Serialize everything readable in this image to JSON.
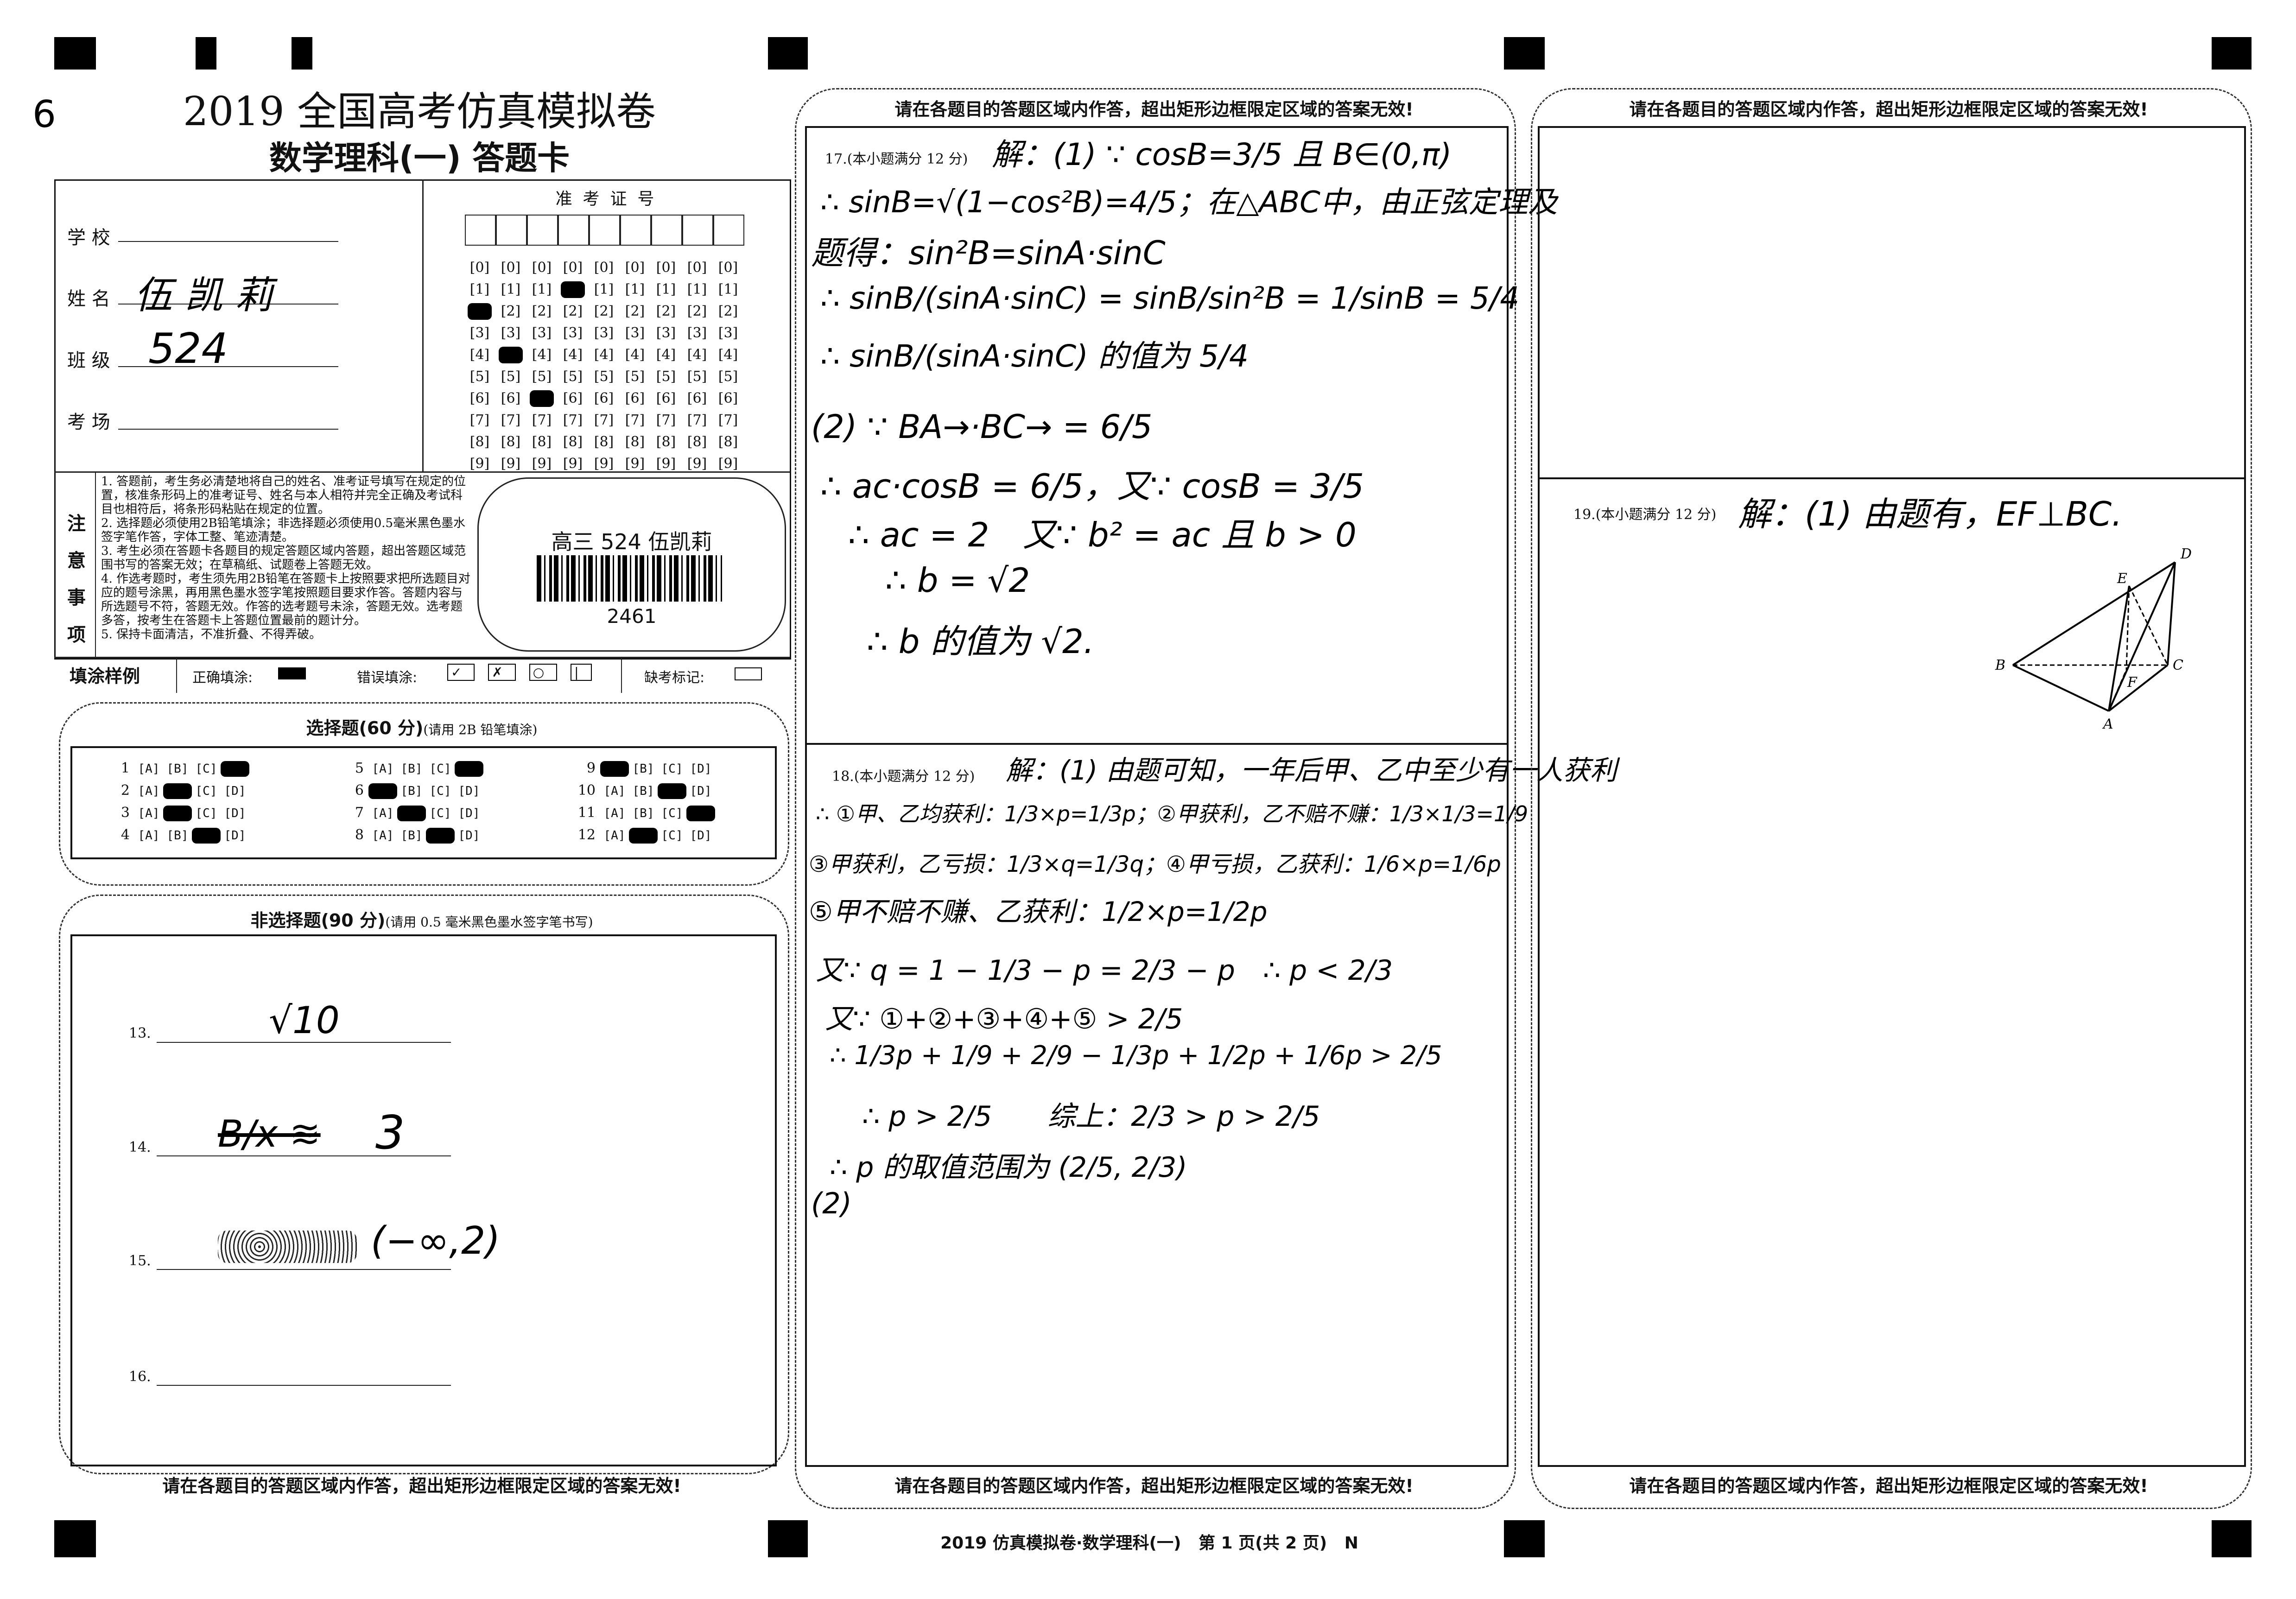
{
  "corner_mark": "6",
  "header": {
    "title": "2019 全国高考仿真模拟卷",
    "subtitle": "数学理科(一)  答题卡"
  },
  "student_info": {
    "school_label": "学 校",
    "school_value": "",
    "name_label": "姓 名",
    "name_value": "伍 凯 莉",
    "class_label": "班 级",
    "class_value": "524",
    "room_label": "考 场",
    "room_value": ""
  },
  "exam_id": {
    "title": "准  考  证  号",
    "digits": [
      "0",
      "1",
      "2",
      "3",
      "4",
      "5",
      "6",
      "7",
      "8",
      "9"
    ],
    "columns": 9,
    "filled": [
      2,
      4,
      6,
      1,
      null,
      null,
      null,
      null,
      null
    ]
  },
  "notes": {
    "label": [
      "注",
      "意",
      "事",
      "项"
    ],
    "items": [
      "1. 答题前，考生务必清楚地将自己的姓名、准考证号填写在规定的位置，核准条形码上的准考证号、姓名与本人相符并完全正确及考试科目也相符后，将条形码粘贴在规定的位置。",
      "2. 选择题必须使用2B铅笔填涂；非选择题必须使用0.5毫米黑色墨水签字笔作答，字体工整、笔迹清楚。",
      "3. 考生必须在答题卡各题目的规定答题区域内答题，超出答题区域范围书写的答案无效；在草稿纸、试题卷上答题无效。",
      "4. 作选考题时，考生须先用2B铅笔在答题卡上按照要求把所选题目对应的题号涂黑，再用黑色墨水签字笔按照题目要求作答。答题内容与所选题号不符，答题无效。作答的选考题号未涂，答题无效。选考题多答，按考生在答题卡上答题位置最前的题计分。",
      "5. 保持卡面清洁，不准折叠、不得弄破。"
    ]
  },
  "barcode": {
    "label": "高三 524 伍凯莉",
    "number": "2461"
  },
  "fill_sample": {
    "title": "填涂样例",
    "correct_label": "正确填涂:",
    "wrong_label": "错误填涂:",
    "absent_label": "缺考标记:"
  },
  "choice": {
    "title": "选择题(60 分)",
    "hint": "(请用 2B 铅笔填涂)",
    "options": [
      "A",
      "B",
      "C",
      "D"
    ],
    "answers": [
      {
        "q": "1",
        "selected": "D"
      },
      {
        "q": "2",
        "selected": "B"
      },
      {
        "q": "3",
        "selected": "B"
      },
      {
        "q": "4",
        "selected": "C"
      },
      {
        "q": "5",
        "selected": "D"
      },
      {
        "q": "6",
        "selected": "A"
      },
      {
        "q": "7",
        "selected": "B"
      },
      {
        "q": "8",
        "selected": "C"
      },
      {
        "q": "9",
        "selected": "A"
      },
      {
        "q": "10",
        "selected": "C"
      },
      {
        "q": "11",
        "selected": "D"
      },
      {
        "q": "12",
        "selected": "B"
      }
    ]
  },
  "non_choice": {
    "title": "非选择题(90 分)",
    "hint": "(请用 0.5 毫米黑色墨水签字笔书写)",
    "blanks": [
      {
        "label": "13.",
        "answer": "√10"
      },
      {
        "label": "14.",
        "answer": "3"
      },
      {
        "label": "15.",
        "answer": "(−∞,2)"
      },
      {
        "label": "16.",
        "answer": ""
      }
    ]
  },
  "warning": "请在各题目的答题区域内作答，超出矩形边框限定区域的答案无效!",
  "q17": {
    "label": "17.(本小题满分 12 分)",
    "lines": [
      "解：(1) ∵ cosB=3/5 且 B∈(0,π)",
      "∴ sinB=√(1−cos²B)=4/5；在△ABC中，由正弦定理及",
      "题得：sin²B=sinA·sinC",
      "∴ sinB/(sinA·sinC) = sinB/sin²B = 1/sinB = 5/4",
      "∴ sinB/(sinA·sinC) 的值为 5/4",
      "(2) ∵ BA→·BC→ = 6/5",
      "∴ ac·cosB = 6/5，又∵ cosB = 3/5",
      "∴ ac = 2　又∵ b² = ac 且 b > 0",
      "∴ b = √2",
      "∴ b 的值为 √2."
    ]
  },
  "q18": {
    "label": "18.(本小题满分 12 分)",
    "lines": [
      "解：(1) 由题可知，一年后甲、乙中至少有一人获利",
      "∴ ①甲、乙均获利：1/3×p=1/3p；②甲获利，乙不赔不赚：1/3×1/3=1/9",
      "③甲获利，乙亏损：1/3×q=1/3q；④甲亏损，乙获利：1/6×p=1/6p",
      "⑤甲不赔不赚、乙获利：1/2×p=1/2p",
      "又∵ q = 1 − 1/3 − p = 2/3 − p　∴ p < 2/3",
      "又∵ ①+②+③+④+⑤ > 2/5",
      "∴ 1/3p + 1/9 + 2/9 − 1/3p + 1/2p + 1/6p > 2/5",
      "∴ p > 2/5　　综上：2/3 > p > 2/5",
      "∴ p 的取值范围为 (2/5, 2/3)",
      "(2)"
    ]
  },
  "q19": {
    "label": "19.(本小题满分 12 分)",
    "lines": [
      "解：(1) 由题有，EF⊥BC."
    ],
    "figure_labels": {
      "A": "A",
      "B": "B",
      "C": "C",
      "D": "D",
      "E": "E",
      "F": "F"
    }
  },
  "footer": "2019 仿真模拟卷·数学理科(一)   第 1 页(共 2 页)   N"
}
